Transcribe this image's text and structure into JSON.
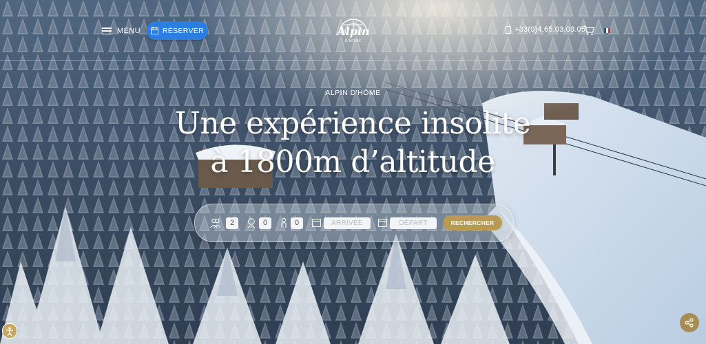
{
  "header": {
    "menu_label": "MENU",
    "reserve_label": "RÉSERVER",
    "logo_text": "Alpin",
    "logo_sub": "D'HOME",
    "phone": "+33(0)4.65.03.03.05",
    "language": "fr"
  },
  "hero": {
    "subtitle": "ALPIN D'HÔME",
    "headline_line1": "Une expérience insolite",
    "headline_line2": "à 1800m d’altitude"
  },
  "search": {
    "adults": "2",
    "children": "0",
    "babies": "0",
    "arrival_placeholder": "ARRIVÉE",
    "departure_placeholder": "DÉPART",
    "search_label": "RECHERCHER"
  },
  "colors": {
    "reserve_blue": "#2c7fe0",
    "gold": "#b99a55"
  },
  "icons": {
    "menu": "hamburger-icon",
    "reserve": "calendar-icon",
    "phone": "phone-icon",
    "cart": "cart-icon",
    "adults": "adults-icon",
    "children": "child-icon",
    "babies": "baby-icon",
    "arrival": "calendar-icon",
    "departure": "calendar-icon",
    "accessibility": "accessibility-icon",
    "share": "share-icon"
  }
}
